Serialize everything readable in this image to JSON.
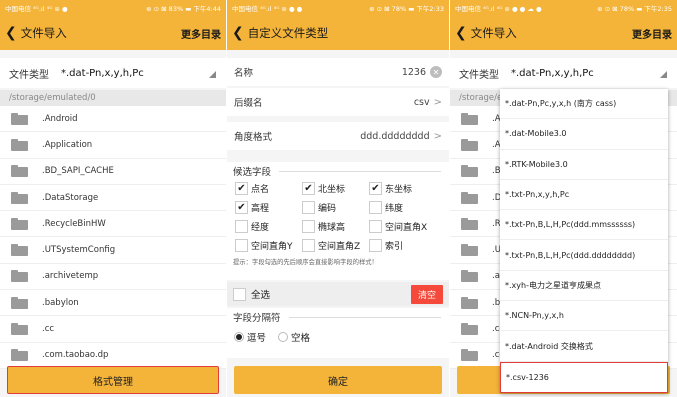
{
  "panel1": {
    "status": {
      "left": "中国电信 ⁴ᴳ.ıl ⁴ᴳ ⊜ ●",
      "right": "⊛ ⊙ ⊠ 83% ▬ 下午4:44"
    },
    "title": "文件导入",
    "right_action": "更多目录",
    "file_type_label": "文件类型",
    "file_type_value": "*.dat-Pn,x,y,h,Pc",
    "path": "/storage/emulated/0",
    "files": [
      ".Android",
      ".Application",
      ".BD_SAPI_CACHE",
      ".DataStorage",
      ".RecycleBinHW",
      ".UTSystemConfig",
      ".archivetemp",
      ".babylon",
      ".cc",
      ".com.taobao.dp"
    ],
    "bottom_button": "格式管理"
  },
  "panel2": {
    "status": {
      "left": "中国电信 ⁴ᴳ.ıl ⁴ᴳ ⊜ ● ●",
      "right": "⊛ ⊙ ⊠ 78% ▬ 下午2:33"
    },
    "title": "自定义文件类型",
    "name_label": "名称",
    "name_value": "1236",
    "suffix_label": "后缀名",
    "suffix_value": "csv",
    "angle_label": "角度格式",
    "angle_value": "ddd.dddddddd",
    "fields_title": "候选字段",
    "fields": [
      {
        "label": "点名",
        "checked": true
      },
      {
        "label": "北坐标",
        "checked": true
      },
      {
        "label": "东坐标",
        "checked": true
      },
      {
        "label": "高程",
        "checked": true
      },
      {
        "label": "编码",
        "checked": false
      },
      {
        "label": "纬度",
        "checked": false
      },
      {
        "label": "经度",
        "checked": false
      },
      {
        "label": "椭球高",
        "checked": false
      },
      {
        "label": "空间直角X",
        "checked": false
      },
      {
        "label": "空间直角Y",
        "checked": false
      },
      {
        "label": "空间直角Z",
        "checked": false
      },
      {
        "label": "索引",
        "checked": false
      }
    ],
    "hint": "提示：字段勾选的先后顺序会直接影响字段的样式！",
    "select_all": "全选",
    "clear_button": "清空",
    "separator_title": "字段分隔符",
    "separators": [
      {
        "label": "逗号",
        "selected": true
      },
      {
        "label": "空格",
        "selected": false
      }
    ],
    "confirm_button": "确定"
  },
  "panel3": {
    "status": {
      "left": "中国电信 ⁴ᴳ.ıl ⁴ᴳ ⊜ ● ● ☁ ●",
      "right": "⊛ ⊙ ⊠ 78% ▬ 下午2:35"
    },
    "title": "文件导入",
    "right_action": "更多目录",
    "file_type_label": "文件类型",
    "file_type_value": "*.dat-Pn,x,y,h,Pc",
    "path": "/storage/em",
    "files": [
      ".Andr",
      ".Appl",
      ".BD_",
      ".Data",
      ".Recy",
      ".UTS",
      ".arch",
      ".baby",
      ".cc",
      ".com"
    ],
    "bottom_button": "格式管理",
    "dropdown_options": [
      "*.dat-Pn,Pc,y,x,h (南方 cass)",
      "*.dat-Mobile3.0",
      "*.RTK-Mobile3.0",
      "*.txt-Pn,x,y,h,Pc",
      "*.txt-Pn,B,L,H,Pc(ddd.mmssssss)",
      "*.txt-Pn,B,L,H,Pc(ddd.dddddddd)",
      "*.xyh-电力之星道亨成果点",
      "*.NCN-Pn,y,x,h",
      "*.dat-Android 交换格式",
      "*.csv-1236"
    ],
    "selected_index": 9
  },
  "colors": {
    "accent": "#f4b43a",
    "clear": "#f4493b",
    "highlight_border": "#e03c3c"
  }
}
